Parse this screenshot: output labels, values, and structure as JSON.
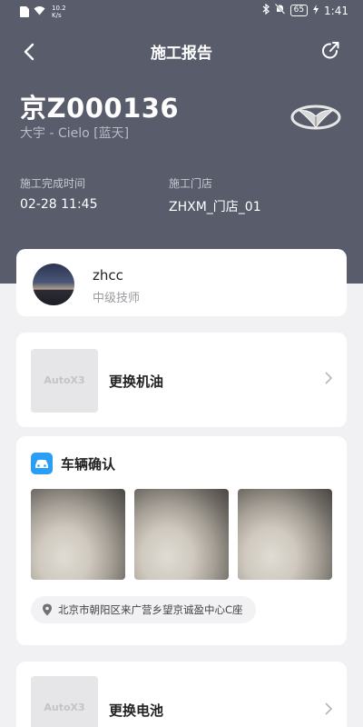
{
  "status_bar": {
    "net_speed": "10.2",
    "net_unit": "K/s",
    "battery": "65",
    "time": "1:41"
  },
  "nav": {
    "title": "施工报告"
  },
  "vehicle": {
    "plate": "京Z000136",
    "model": "大宇 - Cielo [蓝天]"
  },
  "info": {
    "completion_label": "施工完成时间",
    "completion_value": "02-28 11:45",
    "store_label": "施工门店",
    "store_value": "ZHXM_门店_01"
  },
  "technician": {
    "name": "zhcc",
    "level": "中级技师"
  },
  "services": [
    {
      "title": "更换机油",
      "thumb_logo": "AutoX3"
    },
    {
      "title": "更换电池",
      "thumb_logo": "AutoX3"
    }
  ],
  "vehicle_confirm": {
    "title": "车辆确认",
    "location": "北京市朝阳区来广营乡望京诚盈中心C座"
  },
  "colors": {
    "header_bg": "#585c6b",
    "page_bg": "#f1f1f4",
    "accent_blue": "#2a9df4"
  }
}
